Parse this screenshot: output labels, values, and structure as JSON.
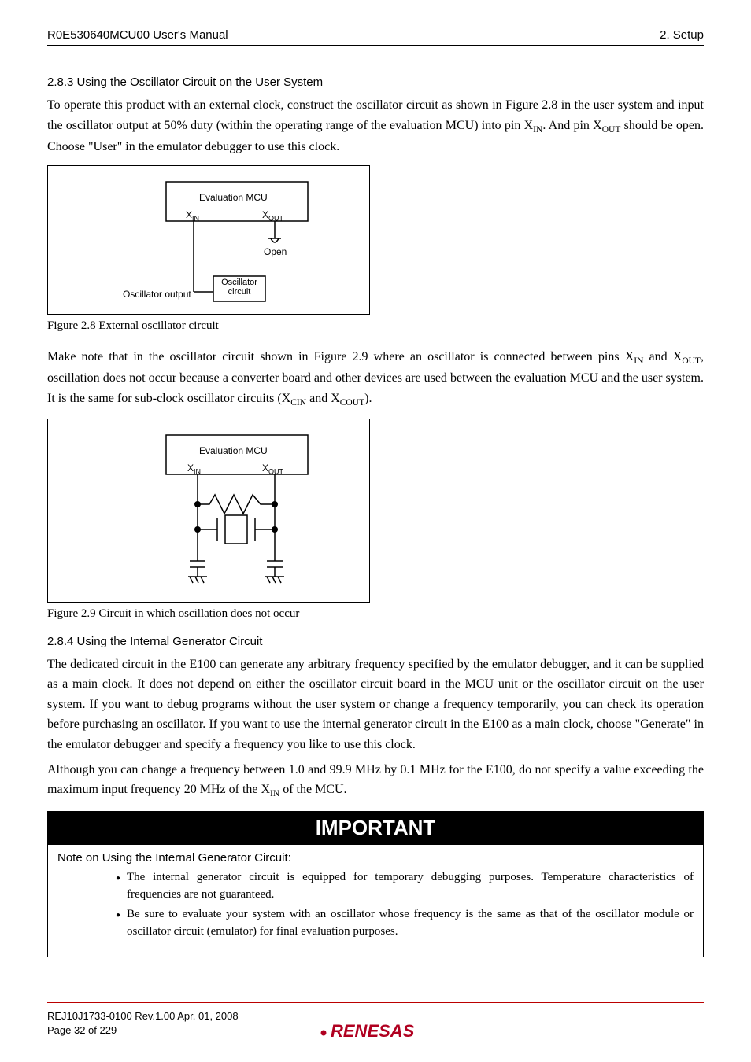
{
  "header": {
    "left": "R0E530640MCU00 User's Manual",
    "right": "2. Setup"
  },
  "sec283": {
    "heading": "2.8.3 Using the Oscillator Circuit on the User System",
    "p1a": "To operate this product with an external clock, construct the oscillator circuit as shown in Figure 2.8 in the user system and input the oscillator output at 50% duty (within the operating range of the evaluation MCU) into pin X",
    "p1b": ". And pin X",
    "p1c": " should be open. Choose \"User\" in the emulator debugger to use this clock.",
    "sub_in": "IN",
    "sub_out": "OUT"
  },
  "fig28": {
    "eval_mcu": "Evaluation MCU",
    "xin": "X",
    "xin_sub": "IN",
    "xout": "X",
    "xout_sub": "OUT",
    "open": "Open",
    "osc_out": "Oscillator output",
    "osc_circ1": "Oscillator",
    "osc_circ2": "circuit",
    "caption": "Figure 2.8 External oscillator circuit"
  },
  "mid": {
    "p1a": "Make note that in the oscillator circuit shown in Figure 2.9 where an oscillator is connected between pins X",
    "p1b": " and X",
    "p1c": ", oscillation does not occur because a converter board and other devices are used between the evaluation MCU and the user system. It is the same for sub-clock oscillator circuits (X",
    "p1d": " and X",
    "p1e": ").",
    "sub_in": "IN",
    "sub_out": "OUT",
    "sub_cin": "CIN",
    "sub_cout": "COUT"
  },
  "fig29": {
    "eval_mcu": "Evaluation MCU",
    "xin": "X",
    "xin_sub": "IN",
    "xout": "X",
    "xout_sub": "OUT",
    "caption": "Figure 2.9 Circuit in which oscillation does not occur"
  },
  "sec284": {
    "heading": "2.8.4 Using the Internal Generator Circuit",
    "p1": "The dedicated circuit in the E100 can generate any arbitrary frequency specified by the emulator debugger, and it can be supplied as a main clock. It does not depend on either the oscillator circuit board in the MCU unit or the oscillator circuit on the user system. If you want to debug programs without the user system or change a frequency temporarily, you can check its operation before purchasing an oscillator. If you want to use the internal generator circuit in the E100 as a main clock, choose \"Generate\" in the emulator debugger and specify a frequency you like to use this clock.",
    "p2a": "Although you can change a frequency between 1.0 and 99.9 MHz by 0.1 MHz for the E100, do not specify a value exceeding the maximum input frequency 20 MHz of the X",
    "p2b": " of the MCU.",
    "sub_in": "IN"
  },
  "important": {
    "banner": "IMPORTANT",
    "title": "Note on Using the Internal Generator Circuit:",
    "b1": "The internal generator circuit is equipped for temporary debugging purposes. Temperature characteristics of frequencies are not guaranteed.",
    "b2": "Be sure to evaluate your system with an oscillator whose frequency is the same as that of the oscillator module or oscillator circuit (emulator) for final evaluation purposes."
  },
  "footer": {
    "line1": "REJ10J1733-0100   Rev.1.00   Apr. 01, 2008",
    "line2": "Page 32 of 229",
    "logo": "RENESAS"
  }
}
